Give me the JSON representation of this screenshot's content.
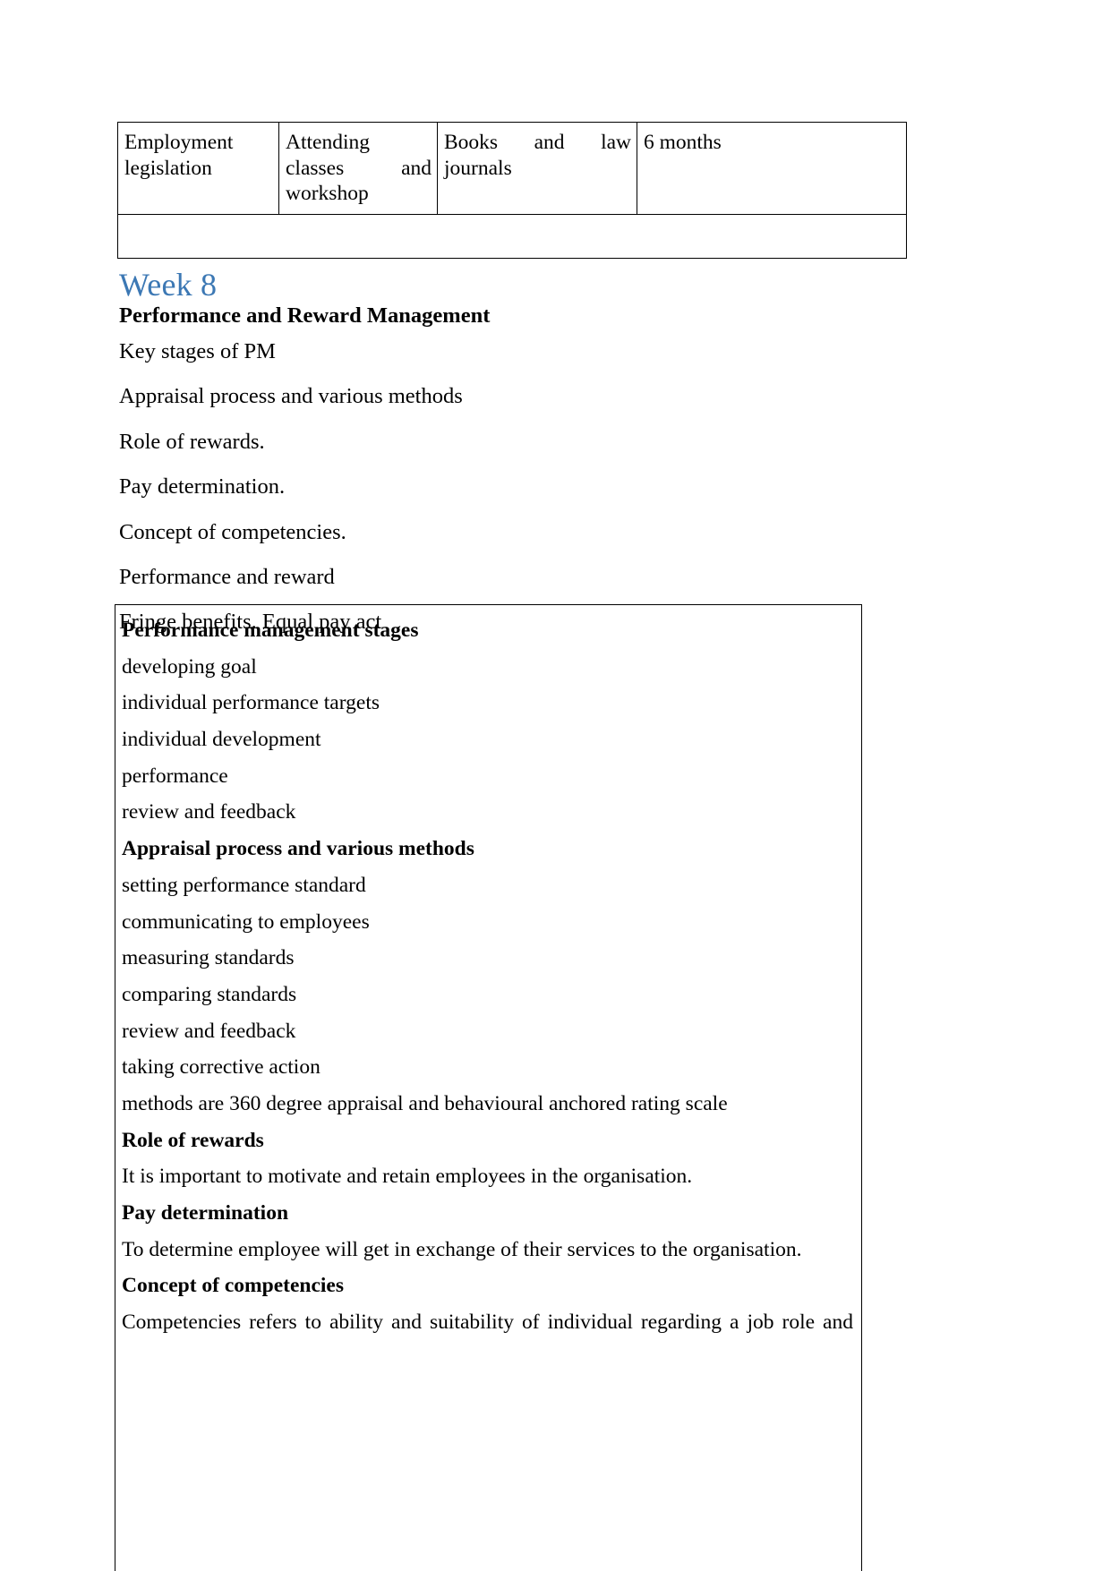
{
  "document": {
    "top_table": {
      "rows": [
        {
          "cells": [
            {
              "text": "Employment legislation",
              "align": "left"
            },
            {
              "text": "Attending classes and workshop",
              "align": "justify"
            },
            {
              "text": "Books and law journals",
              "align": "justify"
            },
            {
              "text": "6 months",
              "align": "left"
            }
          ]
        }
      ],
      "cell_1_line_1": "Employment",
      "cell_1_line_2": "legislation",
      "cell_2_line_1": "Attending",
      "cell_2_line_2": "classes                    and",
      "cell_2_line_3": "workshop",
      "cell_3_line_1": "Books         and        law",
      "cell_3_line_2": "journals",
      "cell_4_line_1": "6 months",
      "empty_row_label": ""
    },
    "week_heading": "Week 8",
    "subtitle": "Performance and Reward Management",
    "body_lines": [
      "Key stages of PM",
      "Appraisal process and various methods",
      "Role of rewards.",
      "Pay determination.",
      "Concept of competencies.",
      "Performance and reward",
      "Fringe benefits. Equal pay act"
    ],
    "box": {
      "lines": [
        {
          "text": "Performance management stages",
          "bold": true
        },
        {
          "text": "developing goal",
          "bold": false
        },
        {
          "text": "individual performance targets",
          "bold": false
        },
        {
          "text": "individual development",
          "bold": false
        },
        {
          "text": "performance",
          "bold": false
        },
        {
          "text": "review and feedback",
          "bold": false
        },
        {
          "text": "Appraisal process and various methods",
          "bold": true
        },
        {
          "text": "setting performance standard",
          "bold": false
        },
        {
          "text": "communicating to employees",
          "bold": false
        },
        {
          "text": "measuring standards",
          "bold": false
        },
        {
          "text": "comparing standards",
          "bold": false
        },
        {
          "text": "review and feedback",
          "bold": false
        },
        {
          "text": "taking corrective action",
          "bold": false
        },
        {
          "text": "methods are 360 degree appraisal and behavioural anchored rating scale",
          "bold": false
        },
        {
          "text": "Role of rewards",
          "bold": true
        },
        {
          "text": "It is important to motivate and retain employees in the organisation.",
          "bold": false
        },
        {
          "text": "Pay determination",
          "bold": true
        },
        {
          "text": "To determine employee will get in exchange of their services to the organisation.",
          "bold": false
        },
        {
          "text": "Concept of competencies",
          "bold": true
        },
        {
          "text": "Competencies refers to ability and suitability of individual regarding a job role and",
          "bold": false,
          "justified": true
        }
      ]
    },
    "colors": {
      "heading_blue": "#3C78B4",
      "text_black": "#000000",
      "border_black": "#000000",
      "page_background": "#FFFFFF"
    }
  }
}
